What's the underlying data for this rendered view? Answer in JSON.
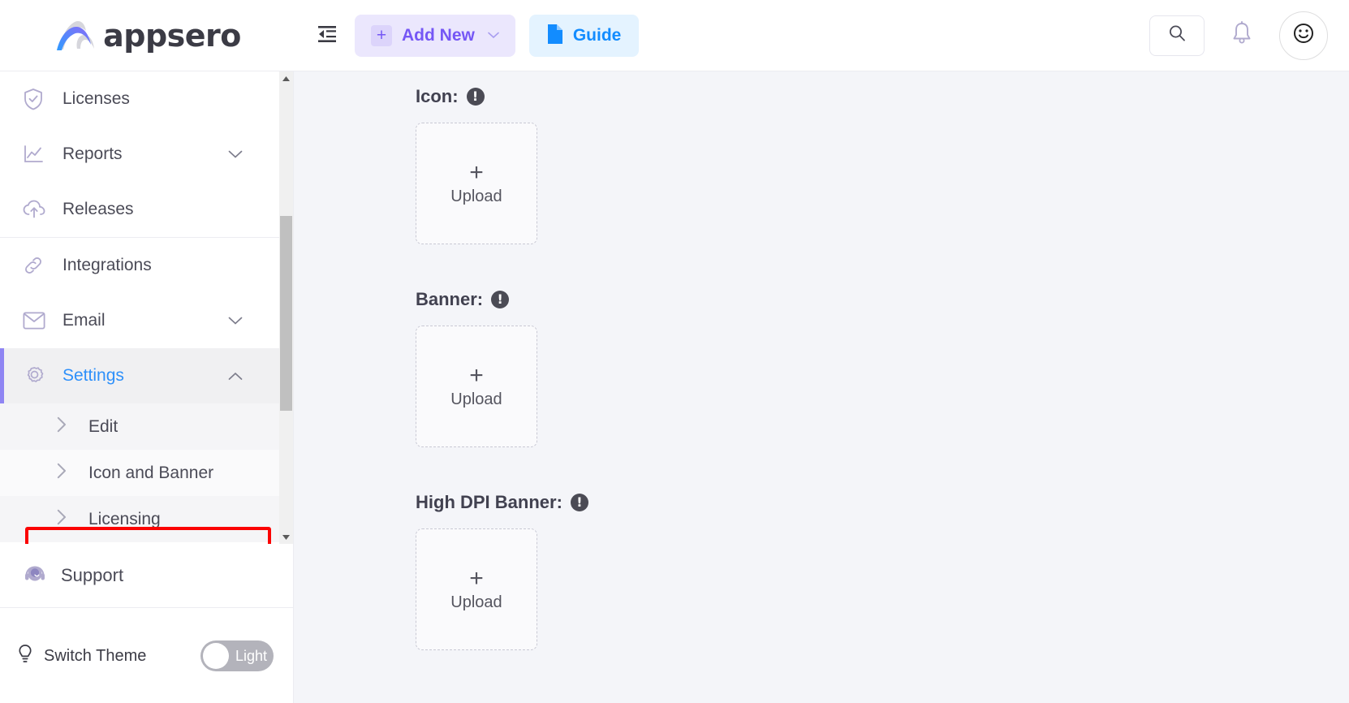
{
  "brand": {
    "name": "appsero",
    "logo_icon": "appsero-swoosh-logo"
  },
  "topbar": {
    "collapse_icon": "collapse-sidebar-icon",
    "add_new": {
      "label": "Add New",
      "plus_icon": "plus-icon",
      "caret_icon": "chevron-down-icon"
    },
    "guide": {
      "label": "Guide",
      "icon": "document-icon"
    },
    "search_icon": "search-icon",
    "notifications_icon": "bell-icon",
    "avatar_icon": "smiley-face-avatar-icon",
    "colors": {
      "add_new_bg": "#ebe7fd",
      "add_new_fg": "#7557f5",
      "guide_bg": "#e4f3ff",
      "guide_fg": "#128cff"
    }
  },
  "sidebar": {
    "items": [
      {
        "label": "Licenses",
        "icon": "shield-check-icon",
        "expandable": false,
        "active": false
      },
      {
        "label": "Reports",
        "icon": "chart-line-icon",
        "expandable": true,
        "chevron": "chevron-down-icon",
        "active": false
      },
      {
        "label": "Releases",
        "icon": "cloud-upload-icon",
        "expandable": false,
        "active": false
      },
      {
        "label": "Integrations",
        "icon": "link-chain-icon",
        "expandable": false,
        "active": false
      },
      {
        "label": "Email",
        "icon": "envelope-icon",
        "expandable": true,
        "chevron": "chevron-down-icon",
        "active": false
      },
      {
        "label": "Settings",
        "icon": "gear-icon",
        "expandable": true,
        "chevron": "chevron-up-icon",
        "active": true
      }
    ],
    "settings_subitems": [
      {
        "label": "Edit",
        "icon": "chevron-right-icon",
        "highlighted": false
      },
      {
        "label": "Icon and Banner",
        "icon": "chevron-right-icon",
        "highlighted": true
      },
      {
        "label": "Licensing",
        "icon": "chevron-right-icon",
        "highlighted": false
      }
    ],
    "support": {
      "label": "Support",
      "icon": "headset-icon"
    },
    "theme": {
      "label": "Switch Theme",
      "icon": "lightbulb-icon",
      "toggle_value": "Light"
    },
    "scrollbar": {
      "up_icon": "scroll-up-arrow-icon",
      "down_icon": "scroll-down-arrow-icon"
    },
    "highlight_color": "#fb0303",
    "active_accent_color": "#8f85f3",
    "active_text_color": "#2e90fa"
  },
  "main": {
    "sections": [
      {
        "label": "Icon:",
        "info_icon": "info-exclamation-icon",
        "upload": {
          "plus": "+",
          "text": "Upload",
          "icon": "upload-plus-icon"
        }
      },
      {
        "label": "Banner:",
        "info_icon": "info-exclamation-icon",
        "upload": {
          "plus": "+",
          "text": "Upload",
          "icon": "upload-plus-icon"
        }
      },
      {
        "label": "High DPI Banner:",
        "info_icon": "info-exclamation-icon",
        "upload": {
          "plus": "+",
          "text": "Upload",
          "icon": "upload-plus-icon"
        }
      }
    ]
  }
}
